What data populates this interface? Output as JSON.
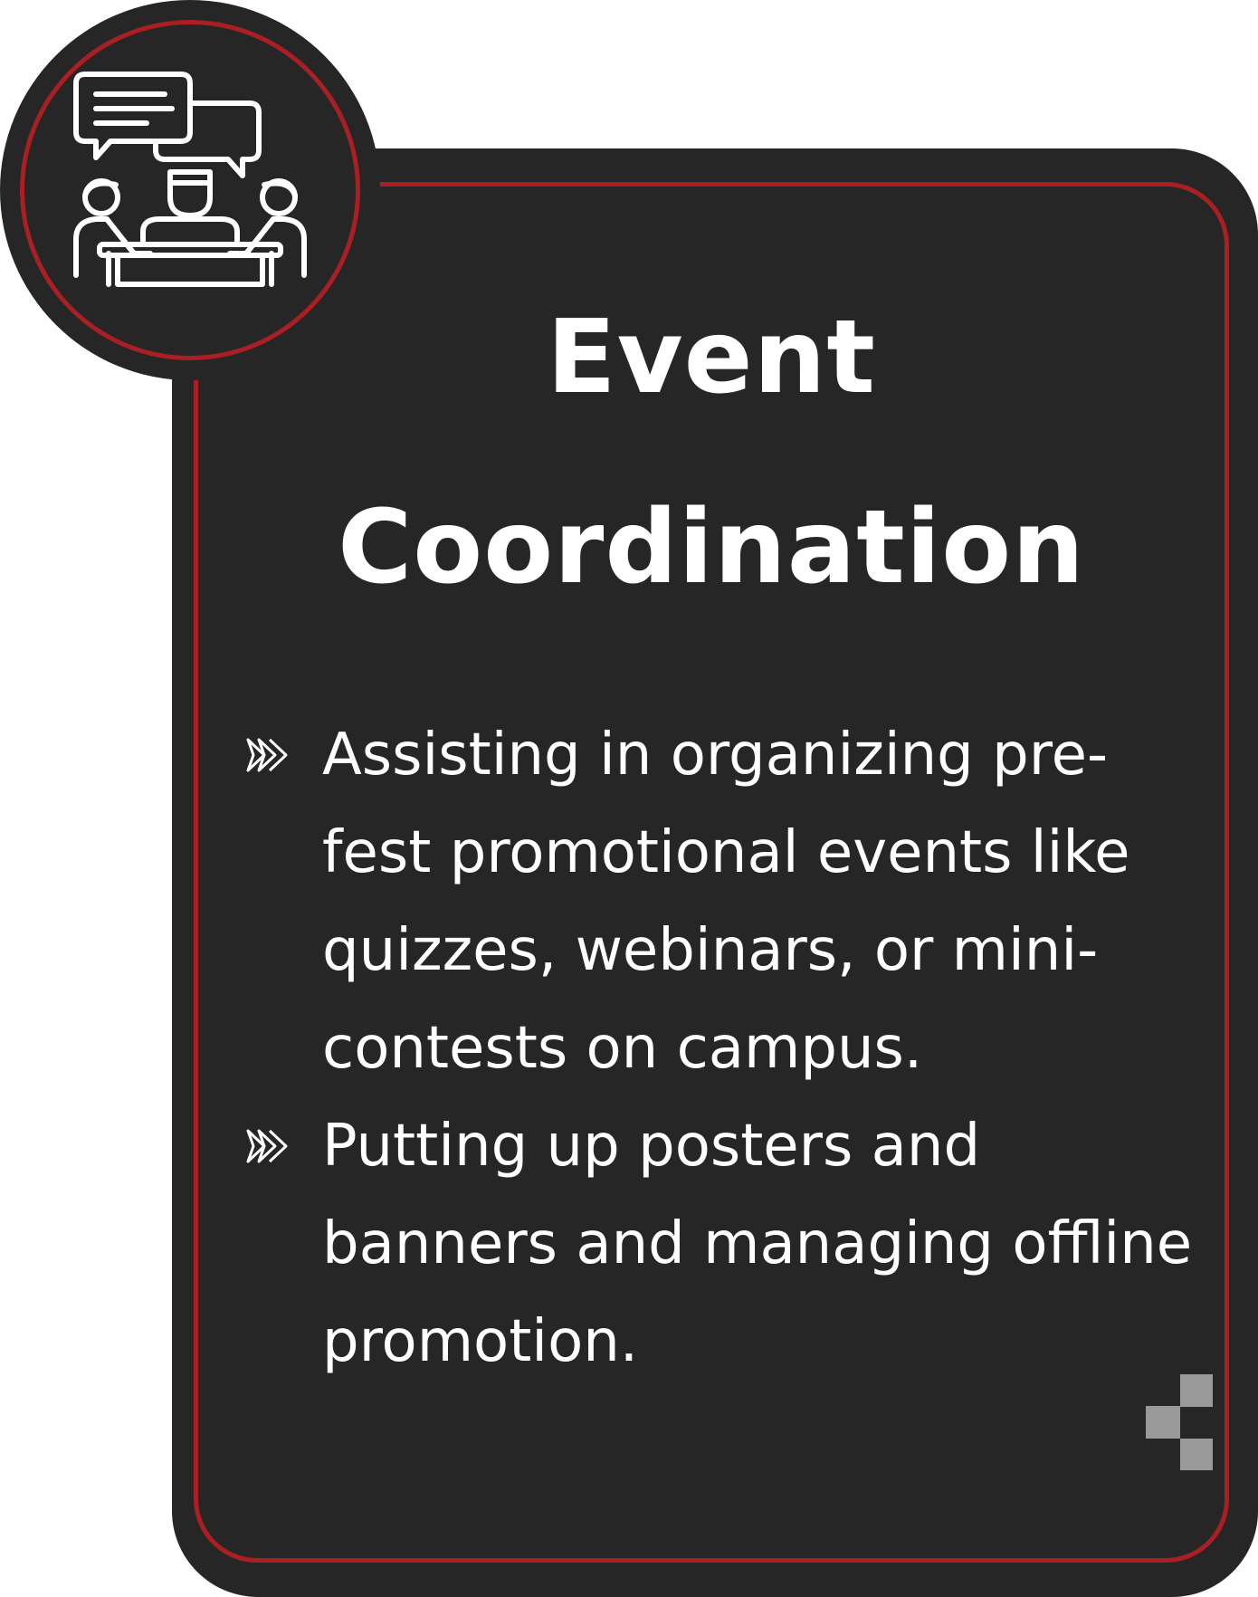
{
  "card": {
    "title_lines": [
      "Event",
      "Coordination"
    ],
    "points": [
      "Assisting in organizing pre-fest promotional events like quizzes, webinars, or mini-contests on campus.",
      "Putting up posters and banners and managing offline promotion."
    ]
  },
  "icons": {
    "badge": "meeting-discussion-icon",
    "bullet": "double-chevron-right-icon",
    "decoration": "pixel-squares-decoration"
  },
  "colors": {
    "card_background": "#262626",
    "accent_red": "#a91f24",
    "text": "#ffffff",
    "decoration_gray": "#9a9a9a"
  }
}
